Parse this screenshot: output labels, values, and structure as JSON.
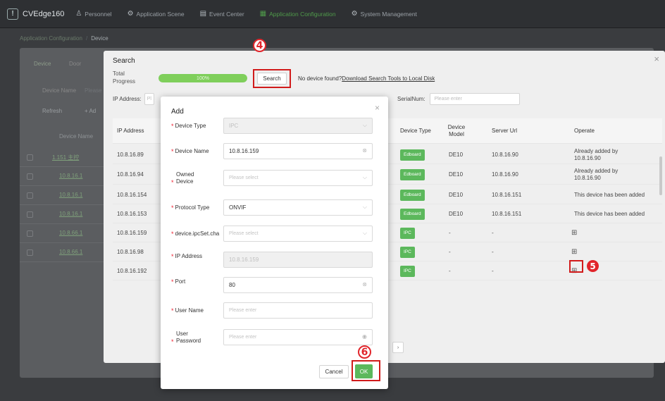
{
  "app": {
    "title": "CVEdge160",
    "logo_glyph": "!"
  },
  "nav": [
    {
      "label": "Personnel",
      "icon": "person-icon",
      "glyph": "♙"
    },
    {
      "label": "Application Scene",
      "icon": "scene-icon",
      "glyph": "⚙"
    },
    {
      "label": "Event Center",
      "icon": "event-icon",
      "glyph": "▤"
    },
    {
      "label": "Application Configuration",
      "icon": "grid-icon",
      "glyph": "▦",
      "active": true
    },
    {
      "label": "System Management",
      "icon": "system-icon",
      "glyph": "⚙"
    }
  ],
  "breadcrumb": {
    "parent": "Application Configuration",
    "sep": "/",
    "current": "Device"
  },
  "background": {
    "tabs": [
      "Device",
      "Door"
    ],
    "device_name_label": "Device Name",
    "device_name_placeholder": "Please",
    "refresh": "Refresh",
    "add": "+ Ad",
    "col_device_name": "Device Name",
    "tree_row": "1.151 主控",
    "links": [
      "10.8.16.1",
      "10.8.16.1",
      "10.8.16.1",
      "10.8.66.1",
      "10.8.66.1"
    ]
  },
  "search": {
    "title": "Search",
    "progress_label": "Total Progress",
    "progress_value": "100%",
    "search_button": "Search",
    "no_device": "No device found?",
    "download_link": "Download Search Tools to Local Disk",
    "ip_label": "IP Address:",
    "ip_placeholder": "Pl",
    "serial_label": "SerialNum:",
    "serial_placeholder": "Please enter",
    "headers": {
      "ip": "IP Address",
      "device_type": "Device Type",
      "device_model": "Device Model",
      "server_url": "Server Url",
      "operate": "Operate"
    },
    "rows": [
      {
        "ip": "10.8.16.89",
        "type": "Edboard",
        "model": "DE10",
        "url": "10.8.16.90",
        "operate": "Already added by 10.8.16.90"
      },
      {
        "ip": "10.8.16.94",
        "type": "Edboard",
        "model": "DE10",
        "url": "10.8.16.90",
        "operate": "Already added by 10.8.16.90"
      },
      {
        "ip": "10.8.16.154",
        "type": "Edboard",
        "model": "DE10",
        "url": "10.8.16.151",
        "operate": "This device has been added"
      },
      {
        "ip": "10.8.16.153",
        "type": "Edboard",
        "model": "DE10",
        "url": "10.8.16.151",
        "operate": "This device has been added"
      },
      {
        "ip": "10.8.16.159",
        "type": "IPC",
        "model": "-",
        "url": "-",
        "operate": ""
      },
      {
        "ip": "10.8.16.98",
        "type": "IPC",
        "model": "-",
        "url": "-",
        "operate": ""
      },
      {
        "ip": "10.8.16.192",
        "type": "IPC",
        "model": "-",
        "url": "-",
        "operate": ""
      }
    ],
    "pager_glyph": "›"
  },
  "add": {
    "title": "Add",
    "fields": [
      {
        "label": "Device Type",
        "value": "IPC",
        "placeholder": "",
        "kind": "select-disabled"
      },
      {
        "label": "Device Name",
        "value": "10.8.16.159",
        "placeholder": "",
        "kind": "input-clear"
      },
      {
        "label": "Owned Device",
        "value": "",
        "placeholder": "Please select",
        "kind": "select"
      },
      {
        "label": "Protocol Type",
        "value": "ONVIF",
        "placeholder": "",
        "kind": "select"
      },
      {
        "label": "device.ipcSet.cha",
        "value": "",
        "placeholder": "Please select",
        "kind": "select"
      },
      {
        "label": "IP Address",
        "value": "10.8.16.159",
        "placeholder": "",
        "kind": "disabled"
      },
      {
        "label": "Port",
        "value": "80",
        "placeholder": "",
        "kind": "input-clear"
      },
      {
        "label": "User Name",
        "value": "",
        "placeholder": "Please enter",
        "kind": "input"
      },
      {
        "label": "User Password",
        "value": "",
        "placeholder": "Please enter",
        "kind": "password"
      }
    ],
    "cancel": "Cancel",
    "ok": "OK"
  },
  "steps": {
    "four": "4",
    "five": "5",
    "six": "6"
  },
  "colors": {
    "accent": "#5cb85c",
    "highlight": "#d11b1b",
    "marker": "#e1252b"
  }
}
